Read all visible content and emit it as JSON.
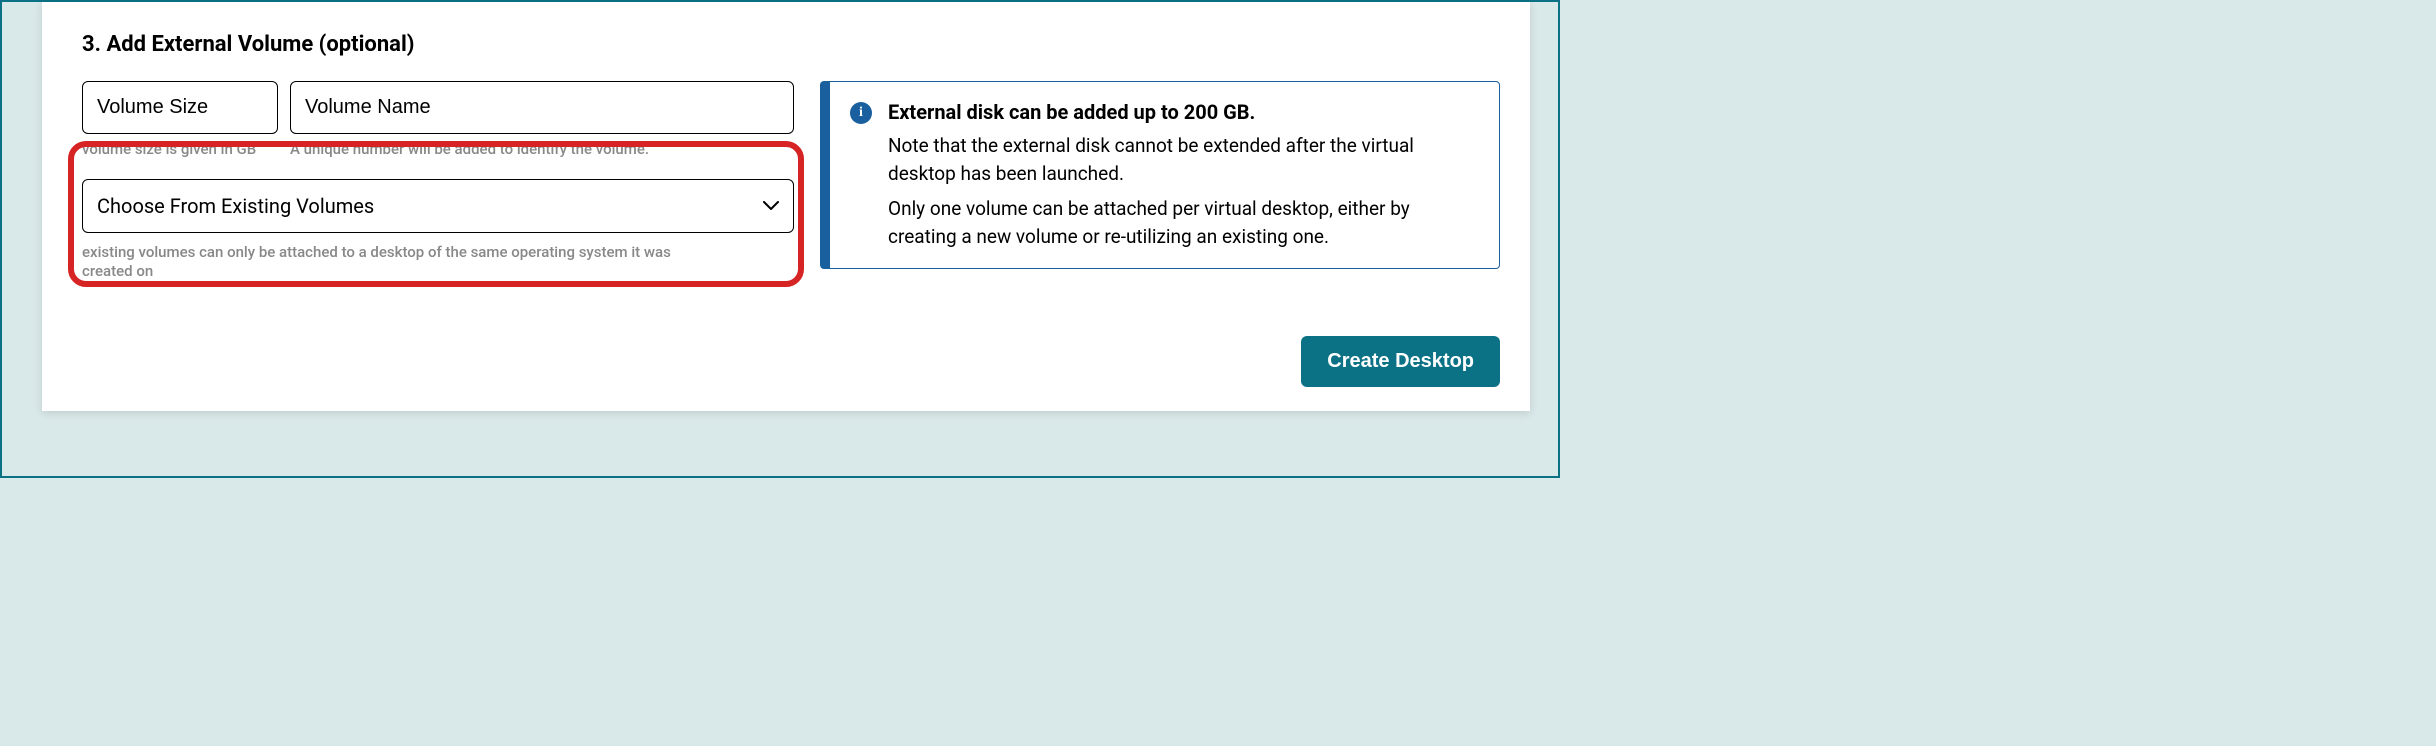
{
  "section": {
    "heading": "3. Add External Volume (optional)"
  },
  "inputs": {
    "volume_size": {
      "placeholder": "Volume Size",
      "value": "",
      "hint": "volume size is given in GB"
    },
    "volume_name": {
      "placeholder": "Volume Name",
      "value": "",
      "hint": "A unique number will be added to identify the volume."
    }
  },
  "dropdown": {
    "label": "Choose From Existing Volumes",
    "hint": "existing volumes can only be attached to a desktop of the same operating system it was created on"
  },
  "info": {
    "title": "External disk can be added up to 200 GB.",
    "p1": "Note that the external disk cannot be extended after the virtual desktop has been launched.",
    "p2": "Only one volume can be attached per virtual desktop, either by creating a new volume or re-utilizing an existing one."
  },
  "buttons": {
    "create_desktop": "Create Desktop"
  },
  "icons": {
    "info_glyph": "i"
  }
}
